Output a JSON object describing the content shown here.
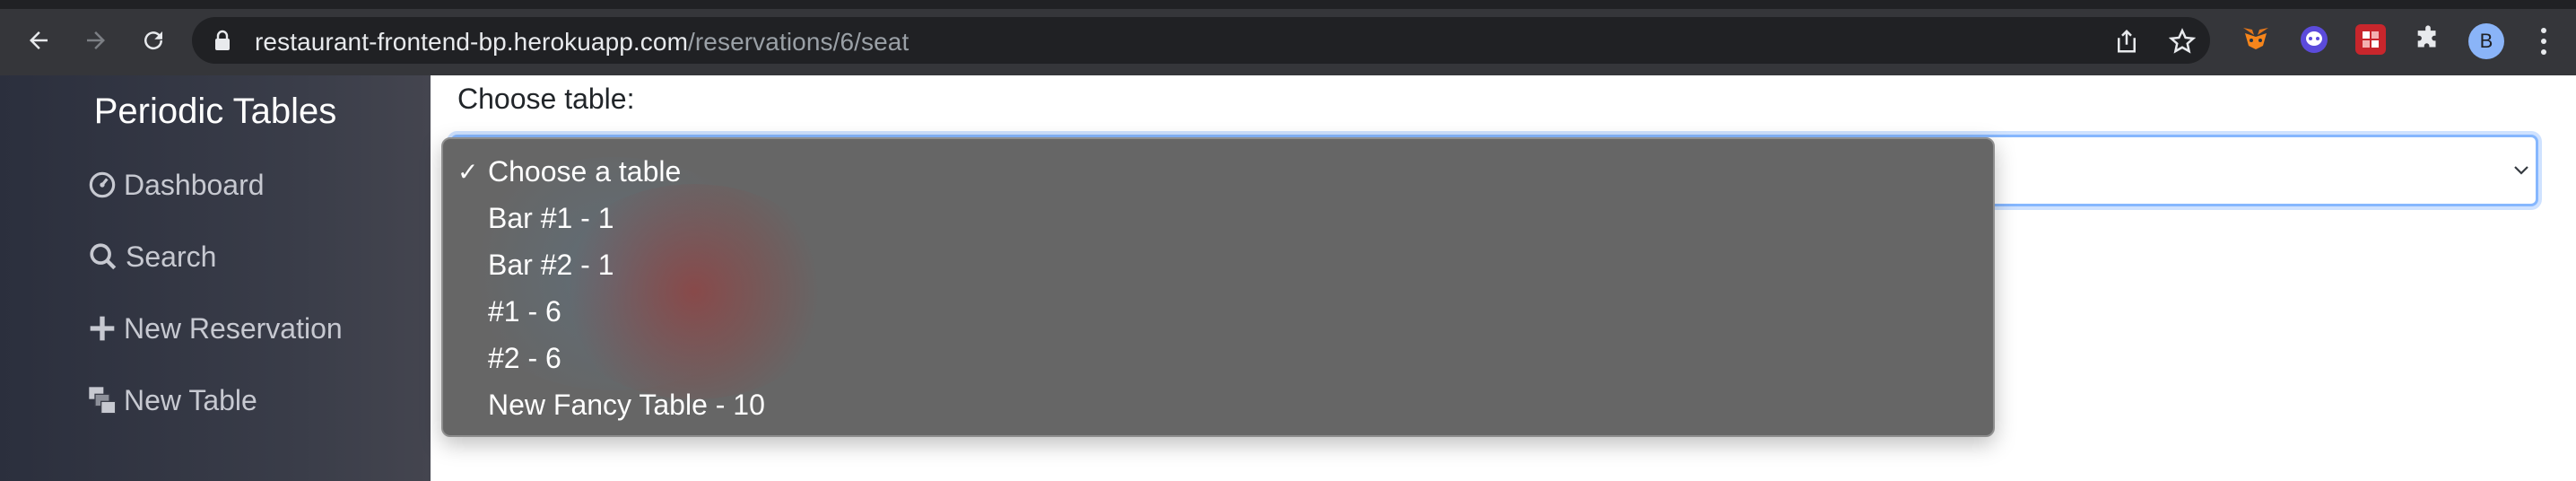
{
  "browser": {
    "url_domain": "restaurant-frontend-bp.herokuapp.com",
    "url_path": "/reservations/6/seat",
    "profile_initial": "B",
    "icons": {
      "back": "back-arrow-icon",
      "forward": "forward-arrow-icon",
      "reload": "reload-icon",
      "lock": "lock-icon",
      "share": "share-icon",
      "bookmark": "star-icon",
      "extensions": [
        "metamask-fox-icon",
        "ghost-extension-icon",
        "red-puzzle-extension-icon",
        "puzzle-piece-icon"
      ],
      "menu": "kebab-menu-icon"
    }
  },
  "sidebar": {
    "title": "Periodic Tables",
    "items": [
      {
        "label": "Dashboard",
        "icon": "dashboard-gauge-icon"
      },
      {
        "label": "Search",
        "icon": "search-icon"
      },
      {
        "label": "New Reservation",
        "icon": "plus-icon"
      },
      {
        "label": "New Table",
        "icon": "layers-icon"
      }
    ]
  },
  "form": {
    "label": "Choose table:",
    "select": {
      "selected": "Choose a table",
      "check_mark": "✓",
      "options": [
        "Choose a table",
        "Bar #1 - 1",
        "Bar #2 - 1",
        "#1 - 6",
        "#2 - 6",
        "New Fancy Table - 10"
      ]
    }
  },
  "colors": {
    "toolbar": "#35363a",
    "omnibox": "#202124",
    "sidebar": "#3a3d49",
    "focus_border": "#86b7fe",
    "dropdown_bg": "#666666"
  }
}
